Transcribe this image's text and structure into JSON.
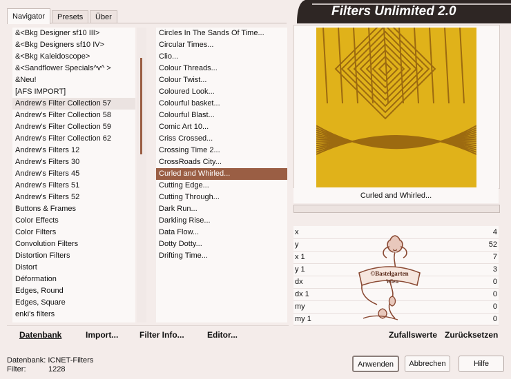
{
  "banner_title": "Filters Unlimited 2.0",
  "tabs": [
    {
      "label": "Navigator",
      "active": true
    },
    {
      "label": "Presets",
      "active": false
    },
    {
      "label": "Über",
      "active": false
    }
  ],
  "categories": [
    "&<Bkg Designer sf10 III>",
    "&<Bkg Designers sf10 IV>",
    "&<Bkg Kaleidoscope>",
    "&<Sandflower Specials^v^ >",
    "&Neu!",
    "[AFS IMPORT]",
    "Andrew's Filter Collection 57",
    "Andrew's Filter Collection 58",
    "Andrew's Filter Collection 59",
    "Andrew's Filter Collection 62",
    "Andrew's Filters 12",
    "Andrew's Filters 30",
    "Andrew's Filters 45",
    "Andrew's Filters 51",
    "Andrew's Filters 52",
    "Buttons & Frames",
    "Color Effects",
    "Color Filters",
    "Convolution Filters",
    "Distortion Filters",
    "Distort",
    "Déformation",
    "Edges, Round",
    "Edges, Square",
    "enki's filters"
  ],
  "filters": [
    "Circles In The Sands Of Time...",
    "Circular Times...",
    "Clio...",
    "Colour Threads...",
    "Colour Twist...",
    "Coloured Look...",
    "Colourful basket...",
    "Colourful Blast...",
    "Comic Art 10...",
    "Criss Crossed...",
    "Crossing Time 2...",
    "CrossRoads City...",
    "Curled and Whirled...",
    "Cutting Edge...",
    "Cutting Through...",
    "Dark Run...",
    "Darkling Rise...",
    "Data Flow...",
    "Dotty Dotty...",
    "Drifting Time..."
  ],
  "selected_filter_caption": "Curled and Whirled...",
  "params": [
    {
      "label": "x",
      "value": "4"
    },
    {
      "label": "y",
      "value": "52"
    },
    {
      "label": "x 1",
      "value": "7"
    },
    {
      "label": "y 1",
      "value": "3"
    },
    {
      "label": "dx",
      "value": "0"
    },
    {
      "label": "dx 1",
      "value": "0"
    },
    {
      "label": "my",
      "value": "0"
    },
    {
      "label": "my 1",
      "value": "0"
    }
  ],
  "watermark": {
    "line1": "©Bastelgarten",
    "line2": "Wien"
  },
  "toolbar": {
    "datenbank": "Datenbank",
    "import": "Import...",
    "filter_info": "Filter Info...",
    "editor": "Editor...",
    "zufallswerte": "Zufallswerte",
    "zuruecksetzen": "Zurücksetzen"
  },
  "status": {
    "db_label": "Datenbank:",
    "db_value": "ICNET-Filters",
    "filter_label": "Filter:",
    "filter_value": "1228"
  },
  "buttons": {
    "apply": "Anwenden",
    "cancel": "Abbrechen",
    "help": "Hilfe"
  },
  "colors": {
    "accent": "#9a5e44",
    "preview_gold": "#e0b21a",
    "preview_dark": "#9c6a10"
  }
}
